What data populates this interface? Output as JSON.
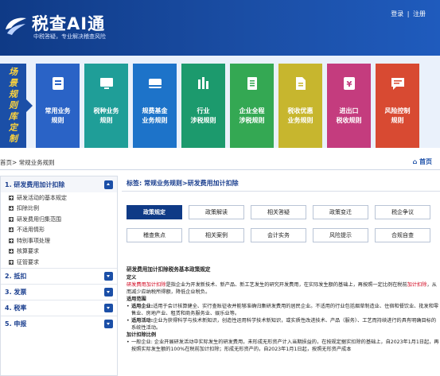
{
  "header": {
    "brand": "税查AI通",
    "tagline": "中税答疑，专业解决稽查风险",
    "login": "登录",
    "separator": "|",
    "register": "注册"
  },
  "banner": {
    "vertical_title": [
      "场",
      "景",
      "规",
      "则",
      "库",
      "定",
      "制"
    ],
    "categories": [
      {
        "label_line1": "常用业务",
        "label_line2": "规则",
        "color": "#2a63c6",
        "icon": "book-icon"
      },
      {
        "label_line1": "税种业务",
        "label_line2": "规则",
        "color": "#1f9e98",
        "icon": "monitor-icon"
      },
      {
        "label_line1": "规费基金",
        "label_line2": "业务规则",
        "color": "#1d73c9",
        "icon": "card-icon"
      },
      {
        "label_line1": "行业",
        "label_line2": "涉税规则",
        "color": "#1c9a6d",
        "icon": "bar-chart-icon"
      },
      {
        "label_line1": "企业全程",
        "label_line2": "涉税规则",
        "color": "#34a853",
        "icon": "document-icon"
      },
      {
        "label_line1": "税收优惠",
        "label_line2": "业务规则",
        "color": "#c7b62e",
        "icon": "file-icon"
      },
      {
        "label_line1": "进出口",
        "label_line2": "税收规则",
        "color": "#c43c7e",
        "icon": "yen-icon"
      },
      {
        "label_line1": "风险控制",
        "label_line2": "规则",
        "color": "#d84a32",
        "icon": "chat-icon"
      }
    ]
  },
  "breadcrumb": {
    "home": "首页",
    "separator": ">",
    "current": "常规业务规则"
  },
  "home_link": "首页",
  "sidebar": {
    "sections": [
      {
        "label": "1. 研发费用加计扣除",
        "expanded": true,
        "items": [
          "研发活动的基本规定",
          "扣除比例",
          "研发费用归集范围",
          "不适用情形",
          "特别事项处理",
          "核算要求",
          "征管要求"
        ]
      },
      {
        "label": "2. 抵扣",
        "expanded": false,
        "items": []
      },
      {
        "label": "3. 发票",
        "expanded": false,
        "items": []
      },
      {
        "label": "4. 税率",
        "expanded": false,
        "items": []
      },
      {
        "label": "5. 申报",
        "expanded": false,
        "items": []
      }
    ]
  },
  "content": {
    "section_label": "标签: 常规业务规则>研发费用加计扣除",
    "tabs": [
      "政策规定",
      "政策解读",
      "相关答疑",
      "政策变迁",
      "税企争议",
      "稽查焦点",
      "相关案例",
      "会计实务",
      "风险提示",
      "合规自查"
    ],
    "active_tab": "政策规定",
    "doc": {
      "title": "研发费用加计扣除税务基本政策规定",
      "definition_heading": "定义",
      "definition_red": "研发费用加计扣除",
      "definition_text": "是指企业为开发新技术、新产品、新工艺发生的研究开发费用，在实际发生额的基础上，再按照一定比例在税前",
      "definition_red2": "加计扣除",
      "definition_text2": "，从而减少应纳税所得额，降低企业税负。",
      "scope_heading": "适用范围",
      "scope_items": [
        {
          "bold": "适用企业:",
          "text": "适用于会计核算健全、实行查账征收并能够准确归集研发费用的居民企业。不适用的行业包括烟草制造业、住宿和餐饮业、批发和零售业、房地产业、租赁和商务服务业、娱乐业等。"
        },
        {
          "bold": "适用活动:",
          "text": "企业为获得科学与技术新知识，创造性运用科学技术新知识，或实质性改进技术、产品（服务）、工艺而持续进行的具有明确目标的系统性活动。"
        }
      ],
      "ratio_heading": "加计扣除比例",
      "ratio_items": [
        {
          "text": "一般企业: 企业开展研发活动中实际发生的研发费用，未形成无形资产计入当期损益的，在按规定据实扣除的基础上，自2023年1月1日起，再按照实际发生额的100%在税前加计扣除；形成无形资产的，自2023年1月1日起，按照无形资产成本"
        }
      ]
    }
  }
}
